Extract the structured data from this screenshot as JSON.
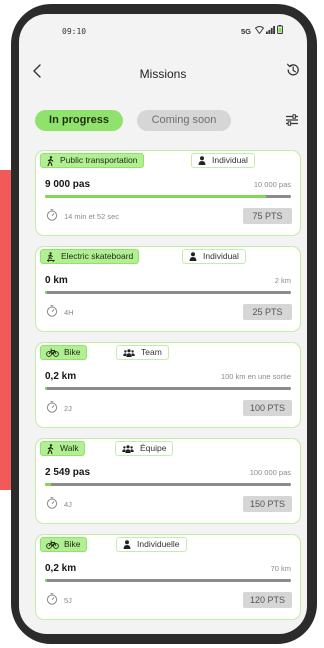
{
  "status_bar": {
    "time": "09:10",
    "network": "5G"
  },
  "header": {
    "title": "Missions"
  },
  "tabs": [
    {
      "label": "In progress",
      "active": true
    },
    {
      "label": "Coming soon",
      "active": false
    }
  ],
  "missions": [
    {
      "category": "Public transportation",
      "category_icon": "walk-icon",
      "mode": "Individual",
      "mode_icon": "person-icon",
      "progress": "9 000 pas",
      "target": "10 000 pas",
      "fraction": 0.9,
      "duration": "14 min et 52 sec",
      "points": "75 PTS"
    },
    {
      "category": "Electric skateboard",
      "category_icon": "skateboard-icon",
      "mode": "Individual",
      "mode_icon": "person-icon",
      "progress": "0 km",
      "target": "2 km",
      "fraction": 0.0,
      "duration": "4H",
      "points": "25 PTS"
    },
    {
      "category": "Bike",
      "category_icon": "bike-icon",
      "mode": "Team",
      "mode_icon": "team-icon",
      "progress": "0,2 km",
      "target": "100 km en une sortie",
      "fraction": 0.002,
      "duration": "2J",
      "points": "100 PTS"
    },
    {
      "category": "Walk",
      "category_icon": "walk-icon",
      "mode": "Équipe",
      "mode_icon": "team-icon",
      "progress": "2 549 pas",
      "target": "100 000 pas",
      "fraction": 0.025,
      "duration": "4J",
      "points": "150 PTS"
    },
    {
      "category": "Bike",
      "category_icon": "bike-icon",
      "mode": "Individuelle",
      "mode_icon": "person-icon",
      "progress": "0,2 km",
      "target": "70 km",
      "fraction": 0.003,
      "duration": "5J",
      "points": "120 PTS"
    }
  ],
  "colors": {
    "accent": "#8fe36d",
    "card_border": "#bfeea6",
    "side_block": "#f25a5a"
  }
}
